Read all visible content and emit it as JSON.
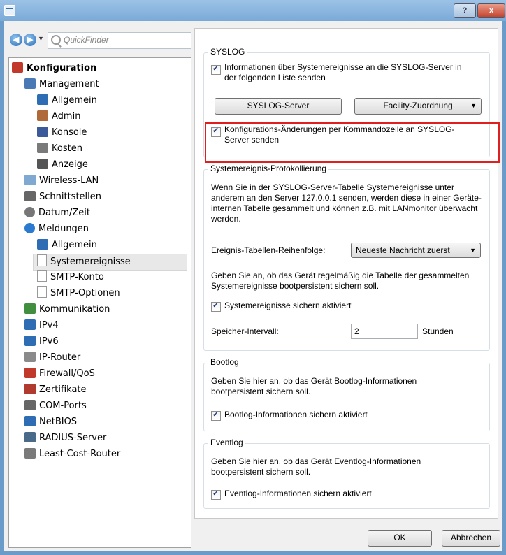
{
  "window": {
    "help": "?",
    "close": "x"
  },
  "nav": {
    "back": "◀",
    "forward": "▶",
    "dropdown": "▼",
    "quickfinder_placeholder": "QuickFinder"
  },
  "tree": [
    {
      "label": "Konfiguration",
      "icon": "tools-icon",
      "bold": true,
      "indent": 0
    },
    {
      "label": "Management",
      "icon": "management-icon",
      "indent": 1
    },
    {
      "label": "Allgemein",
      "icon": "network-icon",
      "indent": 2
    },
    {
      "label": "Admin",
      "icon": "user-icon",
      "indent": 2
    },
    {
      "label": "Konsole",
      "icon": "console-icon",
      "indent": 2
    },
    {
      "label": "Kosten",
      "icon": "costs-icon",
      "indent": 2
    },
    {
      "label": "Anzeige",
      "icon": "display-icon",
      "indent": 2
    },
    {
      "label": "Wireless-LAN",
      "icon": "wireless-icon",
      "indent": 1
    },
    {
      "label": "Schnittstellen",
      "icon": "plug-icon",
      "indent": 1
    },
    {
      "label": "Datum/Zeit",
      "icon": "clock-icon",
      "indent": 1
    },
    {
      "label": "Meldungen",
      "icon": "info-icon",
      "indent": 1
    },
    {
      "label": "Allgemein",
      "icon": "network-icon",
      "indent": 2
    },
    {
      "label": "Systemereignisse",
      "icon": "document-icon",
      "indent": 2,
      "selected": true
    },
    {
      "label": "SMTP-Konto",
      "icon": "document-icon",
      "indent": 2
    },
    {
      "label": "SMTP-Optionen",
      "icon": "document-icon",
      "indent": 2
    },
    {
      "label": "Kommunikation",
      "icon": "communication-icon",
      "indent": 1
    },
    {
      "label": "IPv4",
      "icon": "network-icon",
      "indent": 1
    },
    {
      "label": "IPv6",
      "icon": "network-icon",
      "indent": 1
    },
    {
      "label": "IP-Router",
      "icon": "router-icon",
      "indent": 1
    },
    {
      "label": "Firewall/QoS",
      "icon": "firewall-icon",
      "indent": 1
    },
    {
      "label": "Zertifikate",
      "icon": "certificate-icon",
      "indent": 1
    },
    {
      "label": "COM-Ports",
      "icon": "plug-icon",
      "indent": 1
    },
    {
      "label": "NetBIOS",
      "icon": "network-icon",
      "indent": 1
    },
    {
      "label": "RADIUS-Server",
      "icon": "server-icon",
      "indent": 1
    },
    {
      "label": "Least-Cost-Router",
      "icon": "costs-icon",
      "indent": 1
    }
  ],
  "syslog": {
    "title": "SYSLOG",
    "send_checkbox": "Informationen über Systemereignisse an die SYSLOG-Server in der folgenden Liste senden",
    "send_checked": true,
    "server_button": "SYSLOG-Server",
    "facility_button": "Facility-Zuordnung",
    "config_checkbox": "Konfigurations-Änderungen per Kommandozeile an SYSLOG-Server senden",
    "config_checked": true
  },
  "protocol": {
    "title": "Systemereignis-Protokollierung",
    "description": "Wenn Sie in der SYSLOG-Server-Tabelle Systemereignisse unter anderem an den Server 127.0.0.1 senden, werden diese in einer Geräte-internen Tabelle gesammelt und können z.B. mit LANmonitor überwacht werden.",
    "order_label": "Ereignis-Tabellen-Reihenfolge:",
    "order_value": "Neueste Nachricht zuerst",
    "save_description": "Geben Sie an, ob das Gerät regelmäßig die Tabelle der gesammelten Systemereignisse bootpersistent sichern soll.",
    "save_checkbox": "Systemereignisse sichern aktiviert",
    "save_checked": true,
    "interval_label": "Speicher-Intervall:",
    "interval_value": "2",
    "interval_unit": "Stunden"
  },
  "bootlog": {
    "title": "Bootlog",
    "description": "Geben Sie hier an, ob das Gerät Bootlog-Informationen bootpersistent sichern soll.",
    "checkbox": "Bootlog-Informationen sichern aktiviert",
    "checked": true
  },
  "eventlog": {
    "title": "Eventlog",
    "description": "Geben Sie hier an, ob das Gerät Eventlog-Informationen bootpersistent sichern soll.",
    "checkbox": "Eventlog-Informationen sichern aktiviert",
    "checked": true
  },
  "footer": {
    "ok": "OK",
    "cancel": "Abbrechen"
  },
  "colors": {
    "highlight": "#e02020",
    "titlebar": "#7aaad8"
  }
}
